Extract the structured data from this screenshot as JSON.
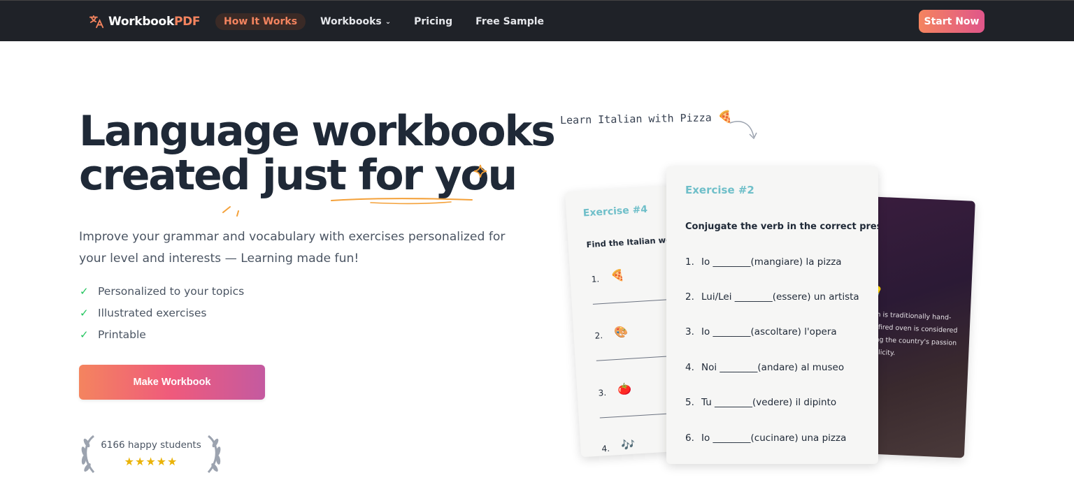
{
  "nav": {
    "logo_text_1": "Workbook",
    "logo_text_2": "PDF",
    "links": [
      {
        "label": "How It Works"
      },
      {
        "label": "Workbooks"
      },
      {
        "label": "Pricing"
      },
      {
        "label": "Free Sample"
      }
    ],
    "start_label": "Start Now"
  },
  "hero": {
    "headline_line1": "Language workbooks",
    "headline_line2": "created just for you",
    "subtitle": "Improve your grammar and vocabulary with exercises personalized for your level and interests — Learning made fun!",
    "features": [
      "Personalized to your topics",
      "Illustrated exercises",
      "Printable"
    ],
    "cta_label": "Make Workbook",
    "students_text": "6166 happy students",
    "stars": "★★★★★"
  },
  "preview": {
    "note": "Learn Italian with Pizza",
    "note_emoji": "🍕",
    "card4": {
      "title": "Exercise #4",
      "instruction": "Find the Italian word",
      "items": [
        {
          "num": "1.",
          "emoji": "🍕"
        },
        {
          "num": "2.",
          "emoji": "🎨"
        },
        {
          "num": "3.",
          "emoji": "🍅"
        },
        {
          "num": "4.",
          "emoji": "🎶"
        }
      ]
    },
    "card2": {
      "title": "Exercise #2",
      "instruction": "Conjugate the verb in the correct present t",
      "items": [
        {
          "num": "1.",
          "text": "Io ________(mangiare) la pizza"
        },
        {
          "num": "2.",
          "text": "Lui/Lei ________(essere) un artista"
        },
        {
          "num": "3.",
          "text": "Io ________(ascoltare) l'opera"
        },
        {
          "num": "4.",
          "text": "Noi ________(andare) al museo"
        },
        {
          "num": "5.",
          "text": "Tu ________(vedere) il dipinto"
        },
        {
          "num": "6.",
          "text": "Io ________(cucinare) una pizza"
        }
      ]
    },
    "photo_card": {
      "lines": [
        "ough is traditionally hand-",
        "ood-fired oven is considered",
        "ecting the country's passion",
        "simplicity."
      ]
    }
  },
  "colors": {
    "nav_bg": "#1f2228",
    "accent_orange": "#f4845f",
    "accent_pink": "#e0568a",
    "exercise_title": "#6fbfc9",
    "check_green": "#22c55e",
    "star_gold": "#eab308"
  }
}
